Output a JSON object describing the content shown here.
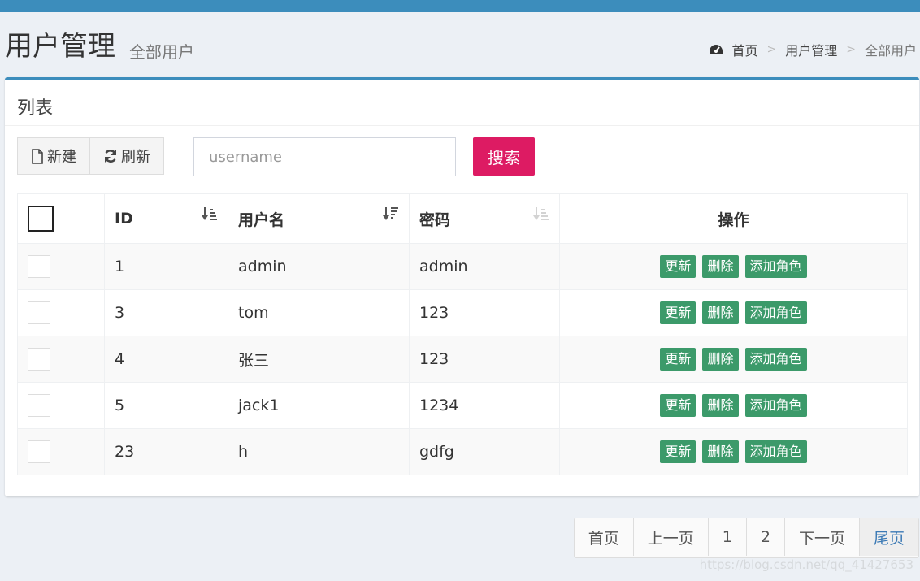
{
  "header": {
    "title": "用户管理",
    "subtitle": "全部用户",
    "breadcrumb": [
      "首页",
      "用户管理",
      "全部用户"
    ]
  },
  "box": {
    "title": "列表",
    "new_label": "新建",
    "refresh_label": "刷新",
    "search_placeholder": "username",
    "search_button": "搜索"
  },
  "table": {
    "columns": [
      "ID",
      "用户名",
      "密码",
      "操作"
    ],
    "rows": [
      {
        "id": "1",
        "username": "admin",
        "password": "admin"
      },
      {
        "id": "3",
        "username": "tom",
        "password": "123"
      },
      {
        "id": "4",
        "username": "张三",
        "password": "123"
      },
      {
        "id": "5",
        "username": "jack1",
        "password": "1234"
      },
      {
        "id": "23",
        "username": "h",
        "password": "gdfg"
      }
    ],
    "actions": [
      "更新",
      "删除",
      "添加角色"
    ]
  },
  "pagination": {
    "first": "首页",
    "prev": "上一页",
    "pages": [
      "1",
      "2"
    ],
    "next": "下一页",
    "last": "尾页"
  },
  "watermark": "https://blog.csdn.net/qq_41427653",
  "colors": {
    "topbar": "#3c8dbc",
    "search_button": "#dd1b63",
    "action_button": "#3c9a6a"
  },
  "icons": [
    "dashboard-icon",
    "file-icon",
    "refresh-icon",
    "sort-asc-icon",
    "sort-desc-icon"
  ]
}
